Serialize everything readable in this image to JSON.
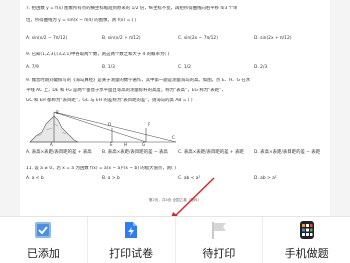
{
  "document": {
    "lines": [
      "7. 把函数 y = f(x) 图象所有点的横坐标缩短到原来的 1/2 倍，纵坐标不变，再把所得曲线向右平移 π/3 个单",
      "位，所得曲线为 y = sin(x − π/4) 的图像，则 f(x) = ( )",
      "9. 已知(1,2,3),(3,2,1)中各取两个数，则这两个数之和大于 4 的概率为( )",
      "9. 魏晋时期刘徽撰写的《海岛算经》是关于测量的数学著作，其中第一题是测量海岛的高。如图，点 E、H、G 在水",
      "平线 AC 上，DE 和 FG 是两个垂直于水平面且等高的测量标杆的高度，称为“表高”，EG 称为“表距”，",
      "GC 和 EH 都称为“表目距”，GC 与 EH 的差称为“表目距的差”，则海岛的高 AB = ( )",
      "11. 设 a ≠ 0，若 x = a 为函数 f(x) = a(x − a)²(x − b) 的极大值点，则( )"
    ],
    "q7_options": [
      "A. sin(x/2 − 7π/12)",
      "B. sin(x/2 + π/12)",
      "C. sin(2x − 7π/12)",
      "D. sin(2x + π/12)"
    ],
    "q8_options": [
      "A. 7/9",
      "B. 1/3",
      "C. 1/2",
      "D. 2/3"
    ],
    "q9_options": [
      "A. 表高×表距/表目距的差 + 表高",
      "B. 表高×表距/表目距的差 − 表高",
      "C. 表高×表距/表目距的差 + 表距",
      "D. 表高×表距/表目距的差 − 表距"
    ],
    "q11_options": [
      "A. a < b",
      "B. a > b",
      "C. ab < a²",
      "D. ab > a²"
    ],
    "figure_labels": {
      "a": "A",
      "b": "B",
      "c": "C",
      "d": "D",
      "e": "E",
      "f": "F",
      "g": "G",
      "h": "H"
    },
    "footer": "第2页，共4页 全国乙卷（理科）"
  },
  "bottom_bar": {
    "items": [
      {
        "label": "已添加",
        "icon": "added-check-icon",
        "color": "#4a90e2"
      },
      {
        "label": "打印试卷",
        "icon": "print-paper-icon",
        "color": "#2e7cf6"
      },
      {
        "label": "待打印",
        "icon": "pending-print-flag-icon",
        "color": "#cfcfcf"
      },
      {
        "label": "手机做题",
        "icon": "phone-grid-icon",
        "color": "#222222"
      }
    ]
  },
  "annotation": {
    "arrow_color": "#e02020"
  }
}
